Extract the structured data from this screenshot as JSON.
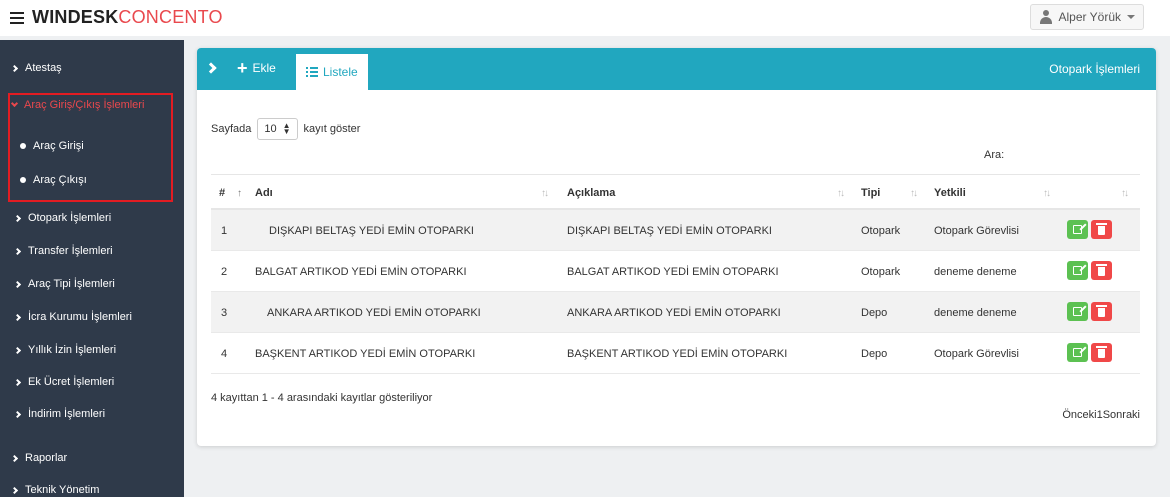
{
  "brand": {
    "bold": "WINDESK",
    "light": "CONCENTO"
  },
  "user": {
    "name": "Alper Yörük"
  },
  "sidebar": {
    "items": [
      {
        "label": "Atestaş"
      },
      {
        "label": "Araç Giriş/Çıkış İşlemleri"
      },
      {
        "label": "Araç Girişi"
      },
      {
        "label": "Araç Çıkışı"
      },
      {
        "label": "Otopark İşlemleri"
      },
      {
        "label": "Transfer İşlemleri"
      },
      {
        "label": "Araç Tipi İşlemleri"
      },
      {
        "label": "İcra Kurumu İşlemleri"
      },
      {
        "label": "Yıllık İzin İşlemleri"
      },
      {
        "label": "Ek Ücret İşlemleri"
      },
      {
        "label": "İndirim İşlemleri"
      },
      {
        "label": "Raporlar"
      },
      {
        "label": "Teknik Yönetim"
      }
    ]
  },
  "panel": {
    "add_label": "Ekle",
    "list_label": "Listele",
    "title": "Otopark İşlemleri",
    "length": {
      "prefix": "Sayfada",
      "value": "10",
      "suffix": "kayıt göster"
    },
    "search_label": "Ara:",
    "columns": [
      "#",
      "Adı",
      "Açıklama",
      "Tipi",
      "Yetkili"
    ],
    "rows": [
      {
        "no": "1",
        "name": "DIŞKAPI BELTAŞ YEDİ EMİN OTOPARKI",
        "desc": "DIŞKAPI BELTAŞ YEDİ EMİN OTOPARKI",
        "type": "Otopark",
        "auth": "Otopark Görevlisi"
      },
      {
        "no": "2",
        "name": "BALGAT ARTIKOD YEDİ EMİN OTOPARKI",
        "desc": "BALGAT ARTIKOD YEDİ EMİN OTOPARKI",
        "type": "Otopark",
        "auth": "deneme deneme"
      },
      {
        "no": "3",
        "name": "ANKARA ARTIKOD YEDİ EMİN OTOPARKI",
        "desc": "ANKARA ARTIKOD YEDİ EMİN OTOPARKI",
        "type": "Depo",
        "auth": "deneme deneme"
      },
      {
        "no": "4",
        "name": "BAŞKENT ARTIKOD YEDİ EMİN OTOPARKI",
        "desc": "BAŞKENT ARTIKOD YEDİ EMİN OTOPARKI",
        "type": "Depo",
        "auth": "Otopark Görevlisi"
      }
    ],
    "info": "4 kayıttan 1 - 4 arasındaki kayıtlar gösteriliyor",
    "pager": {
      "prev": "Önceki",
      "page": "1",
      "next": "Sonraki"
    }
  },
  "colors": {
    "accent": "#21a7bf",
    "brand_red": "#e9484d",
    "sidebar_bg": "#2f3a4a",
    "edit": "#5cc152",
    "delete": "#f04848"
  }
}
